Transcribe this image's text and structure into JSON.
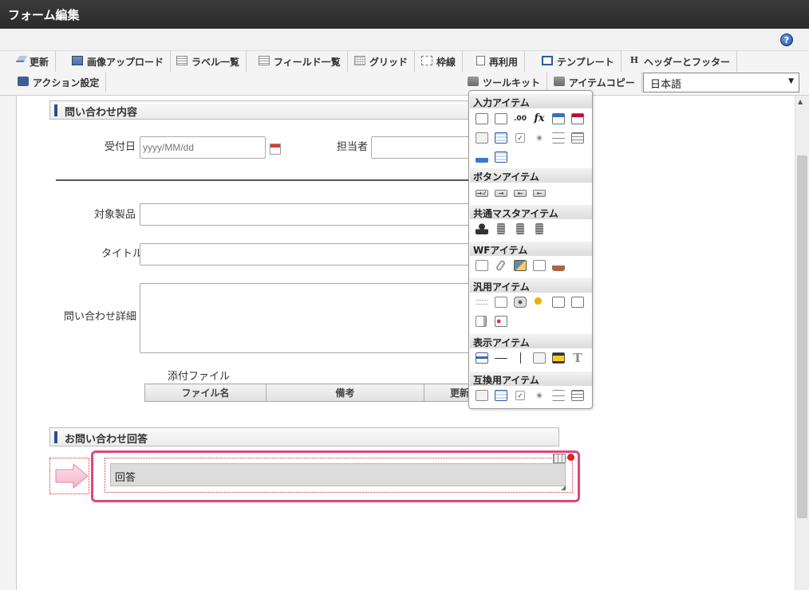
{
  "window": {
    "title": "フォーム編集"
  },
  "toolbar": {
    "row1": [
      {
        "label": "更新",
        "icon": "update-icon"
      },
      {
        "label": "画像アップロード",
        "icon": "image-upload-icon"
      },
      {
        "label": "ラベル一覧",
        "icon": "label-list-icon"
      },
      {
        "label": "フィールド一覧",
        "icon": "field-list-icon"
      },
      {
        "label": "グリッド",
        "icon": "grid-icon"
      },
      {
        "label": "枠線",
        "icon": "border-icon"
      },
      {
        "label": "再利用",
        "icon": "reuse-icon"
      },
      {
        "label": "テンプレート",
        "icon": "template-icon"
      },
      {
        "label": "ヘッダーとフッター",
        "icon": "header-footer-icon"
      }
    ],
    "row2": [
      {
        "label": "アクション設定",
        "icon": "action-settings-icon"
      },
      {
        "label": "ツールキット",
        "icon": "toolkit-icon"
      },
      {
        "label": "アイテムコピー",
        "icon": "item-copy-icon"
      }
    ],
    "language": {
      "selected": "日本語"
    },
    "help": "?"
  },
  "form": {
    "section1_title": "問い合わせ内容",
    "received_date_label": "受付日",
    "received_date_placeholder": "yyyy/MM/dd",
    "assignee_label": "担当者",
    "product_label": "対象製品",
    "title_label": "タイトル",
    "detail_label": "問い合わせ詳細",
    "attachment_label": "添付ファイル",
    "attachment_columns": [
      "ファイル名",
      "備考",
      "更新"
    ],
    "section2_title": "お問い合わせ回答",
    "answer_label": "回答"
  },
  "palette": {
    "sections": [
      {
        "title": "入力アイテム"
      },
      {
        "title": "ボタンアイテム"
      },
      {
        "title": "共通マスタアイテム"
      },
      {
        "title": "WFアイテム"
      },
      {
        "title": "汎用アイテム"
      },
      {
        "title": "表示アイテム"
      },
      {
        "title": "互換用アイテム"
      }
    ],
    "number_icon_text": ".00",
    "fx_icon_text": "fx",
    "text_icon_text": "T"
  },
  "colors": {
    "highlight": "#e0457d",
    "section_accent": "#2d4e8c",
    "titlebar": "#2e2e2e"
  }
}
